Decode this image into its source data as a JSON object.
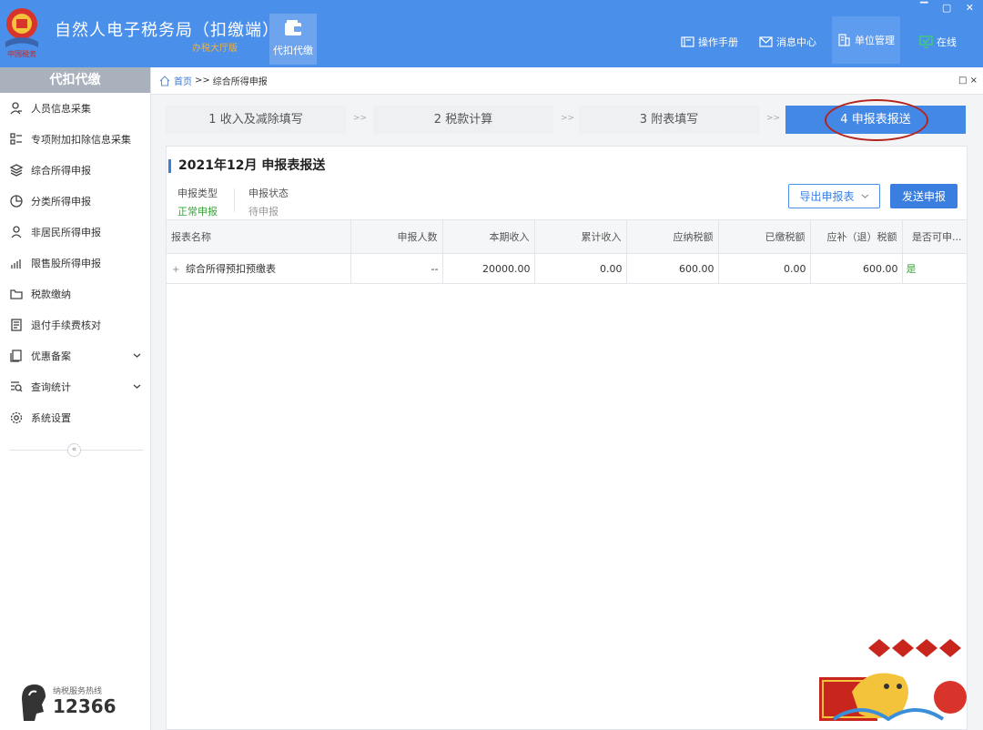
{
  "header": {
    "app_title": "自然人电子税务局（扣缴端）",
    "subtitle": "办税大厅版",
    "nav_tile_label": "代扣代缴",
    "window_controls": "▔ ▢ ✕",
    "links": [
      {
        "label": "操作手册",
        "icon": "book-icon"
      },
      {
        "label": "消息中心",
        "icon": "mail-icon"
      },
      {
        "label": "单位管理",
        "icon": "building-icon"
      },
      {
        "label": "在线",
        "icon": "monitor-check-icon"
      }
    ],
    "colors": {
      "bar": "#4a8fe9",
      "subtitle": "#f2b13a",
      "online": "#3fd46c"
    }
  },
  "sidebar": {
    "title": "代扣代缴",
    "items": [
      {
        "label": "人员信息采集",
        "icon": "person-icon"
      },
      {
        "label": "专项附加扣除信息采集",
        "icon": "list-icon"
      },
      {
        "label": "综合所得申报",
        "icon": "layers-icon"
      },
      {
        "label": "分类所得申报",
        "icon": "pie-icon"
      },
      {
        "label": "非居民所得申报",
        "icon": "person-outline-icon"
      },
      {
        "label": "限售股所得申报",
        "icon": "bar-chart-icon"
      },
      {
        "label": "税款缴纳",
        "icon": "folder-icon"
      },
      {
        "label": "退付手续费核对",
        "icon": "document-icon"
      },
      {
        "label": "优惠备案",
        "icon": "copy-icon",
        "expandable": true
      },
      {
        "label": "查询统计",
        "icon": "search-list-icon",
        "expandable": true
      },
      {
        "label": "系统设置",
        "icon": "gear-icon"
      }
    ],
    "collapse_symbol": "«",
    "hotline": {
      "label": "纳税服务热线",
      "number": "12366"
    }
  },
  "breadcrumb": {
    "home": "首页",
    "separator": ">>",
    "current": "综合所得申报",
    "close": "□ ×"
  },
  "steps": [
    {
      "label": "1 收入及减除填写",
      "active": false
    },
    {
      "label": "2 税款计算",
      "active": false
    },
    {
      "label": "3 附表填写",
      "active": false
    },
    {
      "label": "4 申报表报送",
      "active": true
    }
  ],
  "step_separator": ">>",
  "panel": {
    "period_title": "2021年12月  申报表报送",
    "declare_type_label": "申报类型",
    "declare_type_value": "正常申报",
    "declare_status_label": "申报状态",
    "declare_status_value": "待申报",
    "export_button": "导出申报表",
    "send_button": "发送申报",
    "colors": {
      "accent": "#3a7ee0",
      "green": "#3aa43a",
      "muted": "#999999"
    }
  },
  "table": {
    "headers": [
      "报表名称",
      "申报人数",
      "本期收入",
      "累计收入",
      "应纳税额",
      "已缴税额",
      "应补（退）税额",
      "是否可申..."
    ],
    "rows": [
      {
        "expander": "+",
        "cells": [
          "综合所得预扣预缴表",
          "--",
          "20000.00",
          "0.00",
          "600.00",
          "0.00",
          "600.00",
          "是"
        ]
      }
    ]
  }
}
